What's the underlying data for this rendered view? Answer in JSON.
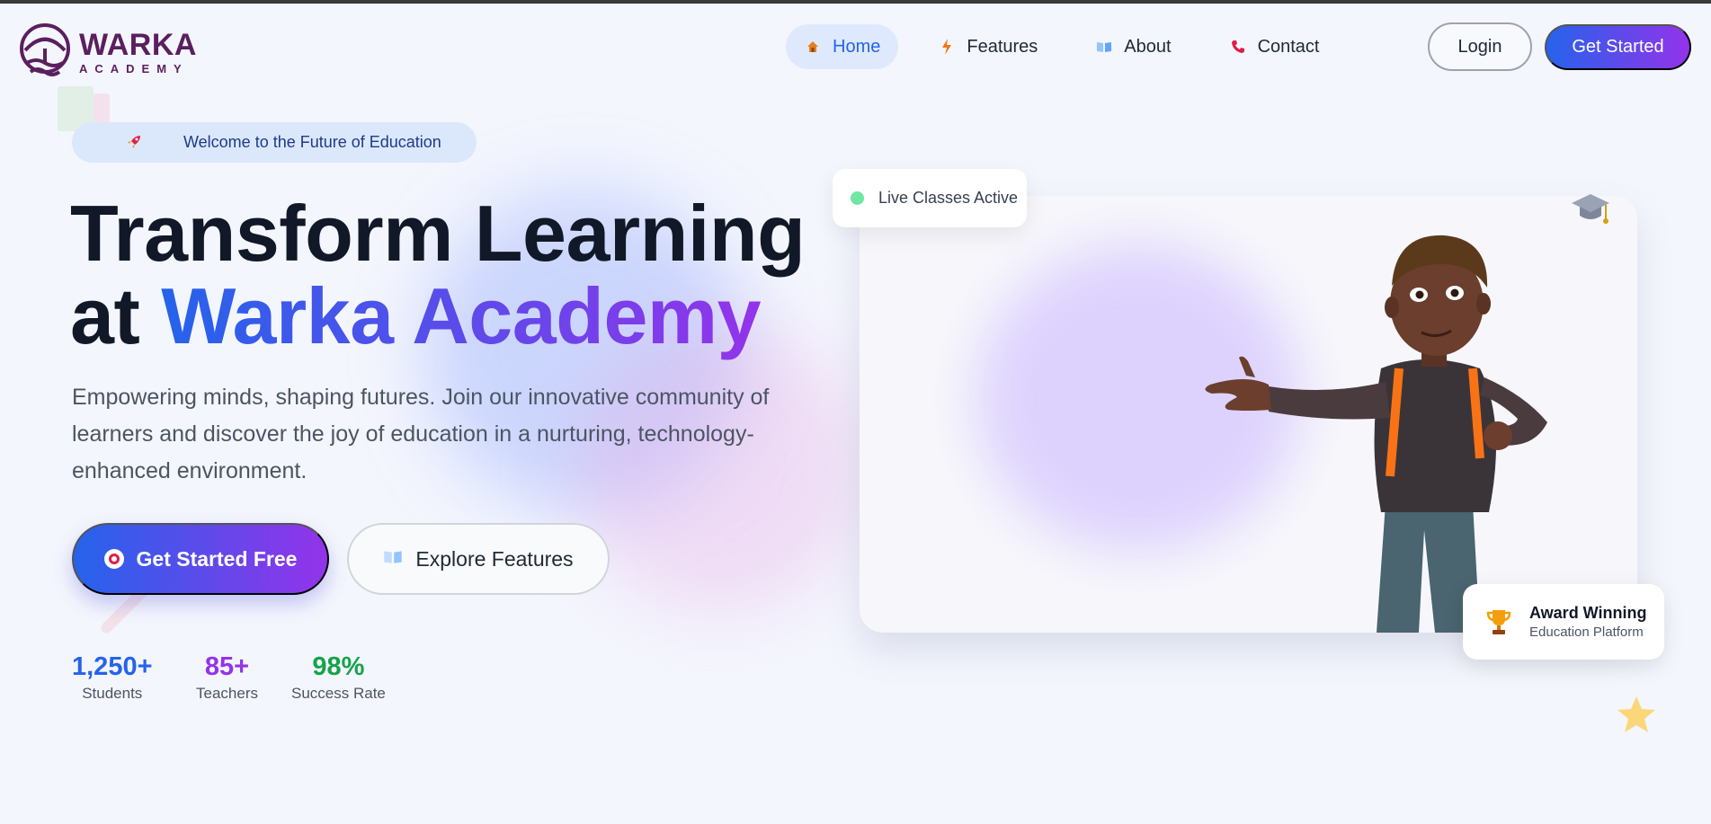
{
  "brand": {
    "name": "WARKA",
    "tagline": "ACADEMY",
    "color": "#5b1f5f"
  },
  "nav": {
    "items": [
      {
        "label": "Home",
        "icon": "house-icon",
        "active": true
      },
      {
        "label": "Features",
        "icon": "lightning-icon",
        "active": false
      },
      {
        "label": "About",
        "icon": "book-icon",
        "active": false
      },
      {
        "label": "Contact",
        "icon": "phone-icon",
        "active": false
      }
    ],
    "login_label": "Login",
    "get_started_label": "Get Started"
  },
  "hero": {
    "badge": "Welcome to the Future of Education",
    "badge_icon": "rocket-icon",
    "title_line1": "Transform Learning",
    "title_line2_prefix": "at ",
    "title_line2_highlight": "Warka Academy",
    "description": "Empowering minds, shaping futures. Join our innovative community of learners and discover the joy of education in a nurturing, technology-enhanced environment.",
    "primary_button": "Get Started Free",
    "primary_button_icon": "target-icon",
    "secondary_button": "Explore Features",
    "secondary_button_icon": "book-icon"
  },
  "stats": [
    {
      "value": "1,250+",
      "label": "Students",
      "color": "#2563eb"
    },
    {
      "value": "85+",
      "label": "Teachers",
      "color": "#9333ea"
    },
    {
      "value": "98%",
      "label": "Success Rate",
      "color": "#16a34a"
    }
  ],
  "showcase": {
    "live_badge": "Live Classes Active",
    "award_title": "Award Winning",
    "award_subtitle": "Education Platform",
    "award_icon": "trophy-icon",
    "decor_icons": [
      "graduation-cap-icon",
      "star-icon"
    ]
  },
  "colors": {
    "accent_blue": "#2563eb",
    "accent_purple": "#9333ea",
    "background": "#f4f6fd"
  }
}
